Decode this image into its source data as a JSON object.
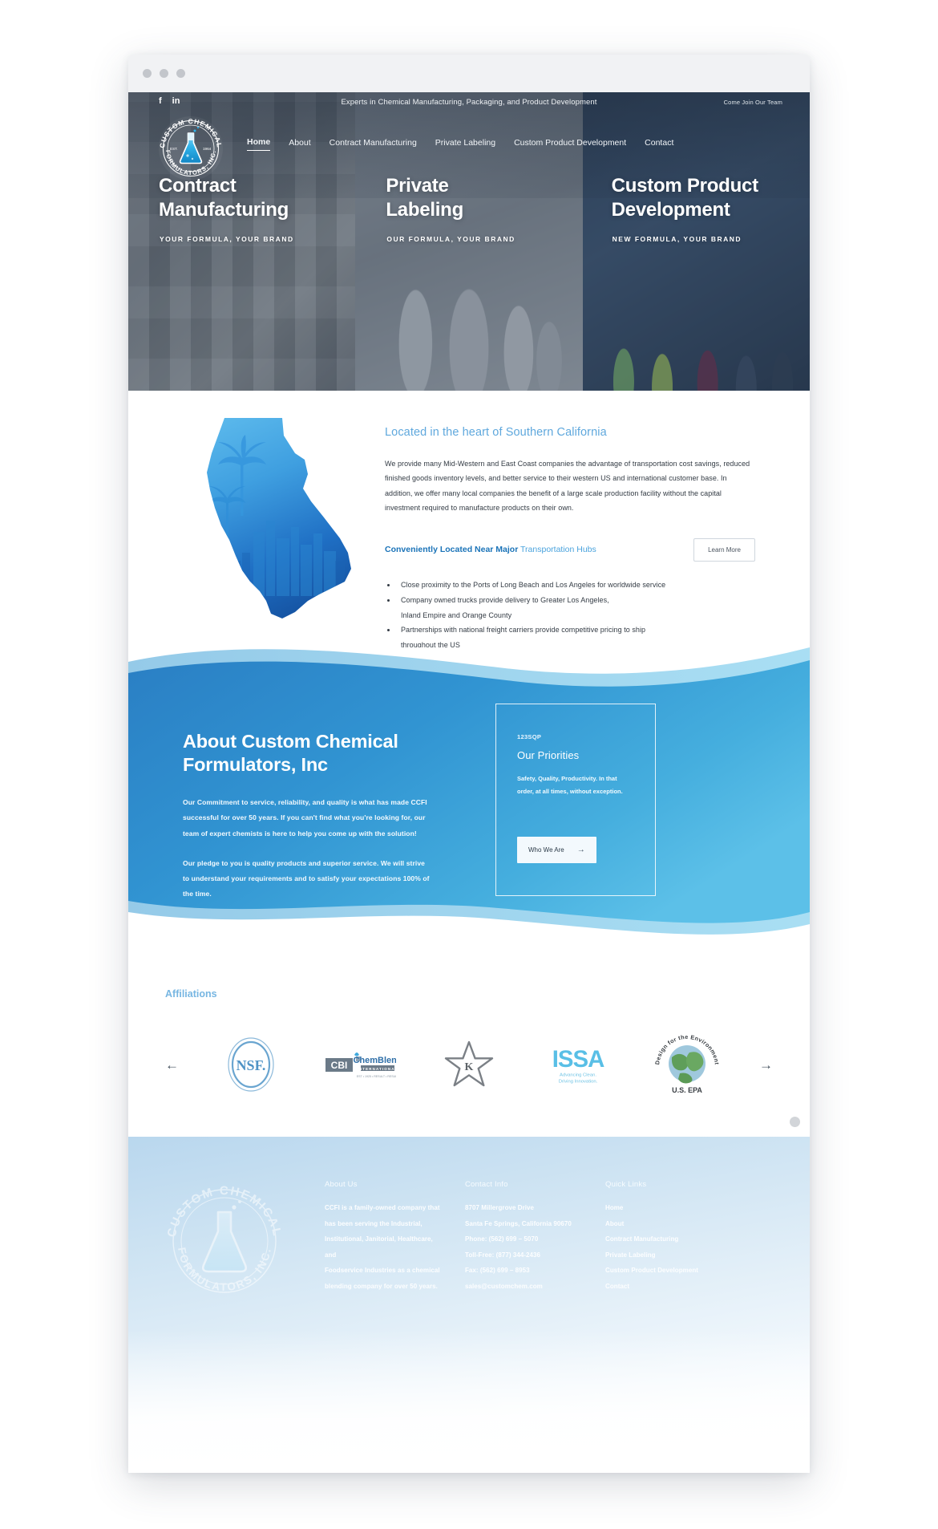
{
  "site": {
    "logo_alt": "Custom Chemical Formulators, Inc.",
    "logo_top_text": "CUSTOM CHEMICAL",
    "logo_bottom_text": "FORMULATORS, INC.",
    "logo_est_left": "EST.",
    "logo_est_right": "1964"
  },
  "topbar": {
    "facebook": "f",
    "linkedin": "in",
    "tagline": "Experts in Chemical Manufacturing, Packaging, and Product Development",
    "join": "Come Join Our Team"
  },
  "nav": {
    "items": [
      {
        "label": "Home",
        "active": true
      },
      {
        "label": "About",
        "active": false
      },
      {
        "label": "Contract Manufacturing",
        "active": false
      },
      {
        "label": "Private Labeling",
        "active": false
      },
      {
        "label": "Custom Product Development",
        "active": false
      },
      {
        "label": "Contact",
        "active": false
      }
    ]
  },
  "hero": {
    "panels": [
      {
        "title_line1": "Contract",
        "title_line2": "Manufacturing",
        "subtitle": "YOUR FORMULA, YOUR BRAND"
      },
      {
        "title_line1": "Private",
        "title_line2": "Labeling",
        "subtitle": "OUR FORMULA, YOUR BRAND"
      },
      {
        "title_line1": "Custom Product",
        "title_line2": "Development",
        "subtitle": "NEW FORMULA, YOUR BRAND"
      }
    ]
  },
  "california": {
    "heading": "Located in the heart of Southern California",
    "paragraph": "We provide many Mid-Western and East Coast companies the advantage of transportation cost savings, reduced finished goods inventory levels, and better service to their western US and international customer base. In addition, we offer many local companies the benefit of a large scale production facility without the capital investment required to manufacture products on their own.",
    "subheading_bold": "Conveniently Located Near Major",
    "subheading_light": " Transportation Hubs",
    "learn_more": "Learn More",
    "bullets": [
      {
        "line1": "Close proximity to the Ports of Long Beach and Los Angeles for worldwide service",
        "line2": ""
      },
      {
        "line1": "Company owned trucks provide delivery to Greater Los Angeles,",
        "line2": "Inland Empire and Orange County"
      },
      {
        "line1": "Partnerships with national freight carriers provide competitive pricing to ship",
        "line2": "throughout the US"
      }
    ]
  },
  "about": {
    "heading_line1": "About Custom Chemical",
    "heading_line2": "Formulators, Inc",
    "paragraph1": "Our Commitment to service, reliability, and quality is what has made CCFI successful for over 50 years. If you can't find what you're looking for, our team of expert chemists is here to help you come up with the solution!",
    "paragraph2": "Our pledge to you is quality products and superior service. We will strive to understand your requirements and to satisfy your expectations 100% of the time.",
    "card": {
      "code": "123SQP",
      "title": "Our Priorities",
      "body": "Safety, Quality, Productivity. In that order, at all times, without exception.",
      "button": "Who We Are",
      "button_arrow": "→"
    }
  },
  "affiliations": {
    "heading": "Affiliations",
    "prev_arrow": "←",
    "next_arrow": "→",
    "logos": [
      {
        "name": "nsf-logo",
        "text": "NSF."
      },
      {
        "name": "chemblend-logo",
        "text": "ChemBlend",
        "sub": "INTERNATIONAL"
      },
      {
        "name": "kosher-star-k-logo",
        "text": "K"
      },
      {
        "name": "issa-logo",
        "text": "ISSA",
        "sub1": "Advancing Clean.",
        "sub2": "Driving Innovation."
      },
      {
        "name": "epa-design-for-environment-logo",
        "text": "Design for the Environment",
        "sub": "U.S. EPA"
      }
    ]
  },
  "footer": {
    "about": {
      "heading": "About Us",
      "lines": [
        "CCFI is a family-owned company that",
        "has been serving the Industrial,",
        "Institutional, Janitorial, Healthcare, and",
        "Foodservice Industries as a chemical",
        "blending company for over 50 years."
      ]
    },
    "contact": {
      "heading": "Contact Info",
      "lines": [
        "8707 Millergrove Drive",
        "Santa Fe Springs, California 90670",
        "Phone: (562) 699 – 5070",
        "Toll-Free: (877) 344-2436",
        "Fax: (562) 699 – 8953",
        "sales@customchem.com"
      ]
    },
    "quick_links": {
      "heading": "Quick Links",
      "links": [
        "Home",
        "About",
        "Contract Manufacturing",
        "Private Labeling",
        "Custom Product Development",
        "Contact"
      ]
    }
  },
  "colors": {
    "accent_blue": "#4aa3dd",
    "deep_blue": "#1a73b8",
    "about_blue": "#2f8fd0",
    "hero_dark": "#2d3a4c"
  }
}
